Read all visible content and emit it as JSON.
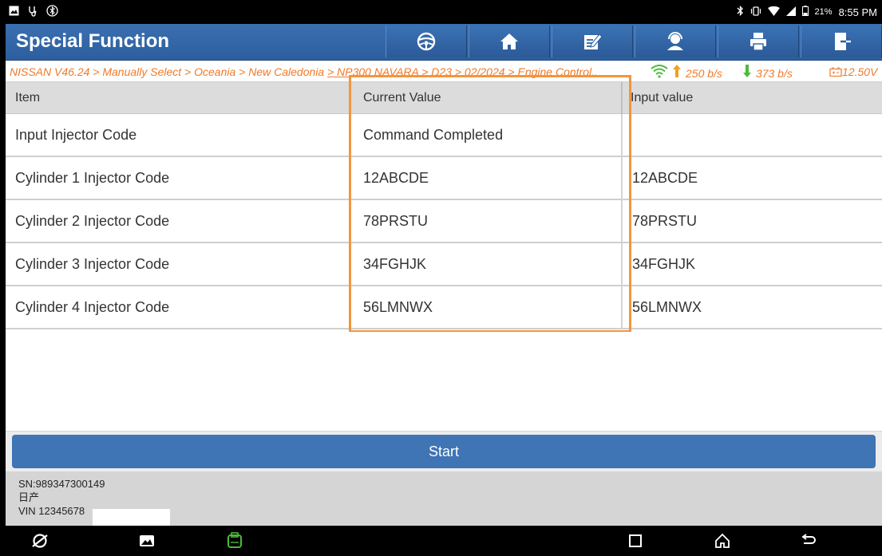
{
  "statusbar": {
    "left_icons": [
      "image-icon",
      "stethoscope-icon",
      "bluetooth-settings-icon"
    ],
    "right_icons": [
      "bluetooth-icon",
      "vibrate-icon",
      "wifi-icon",
      "signal-icon",
      "battery-icon"
    ],
    "battery": "21%",
    "time": "8:55 PM"
  },
  "header": {
    "title": "Special Function",
    "toolbar": [
      "steering-wheel-icon",
      "home-icon",
      "edit-icon",
      "support-user-icon",
      "print-icon",
      "exit-icon"
    ]
  },
  "breadcrumb": {
    "plain": "NISSAN V46.24 > Manually Select > Oceania > New Caledonia ",
    "underlined": "> NP300 NAVARA > D23 > 02/2024 > Engine Control..",
    "upload": "250 b/s",
    "download": "373 b/s",
    "voltage": "12.50V"
  },
  "table": {
    "columns": [
      "Item",
      "Current Value",
      "Input value"
    ],
    "rows": [
      {
        "item": "Input Injector Code",
        "current": "Command Completed",
        "input": ""
      },
      {
        "item": "Cylinder 1 Injector Code",
        "current": "12ABCDE",
        "input": "12ABCDE"
      },
      {
        "item": "Cylinder 2 Injector Code",
        "current": "78PRSTU",
        "input": "78PRSTU"
      },
      {
        "item": "Cylinder 3 Injector Code",
        "current": "34FGHJK",
        "input": "34FGHJK"
      },
      {
        "item": "Cylinder 4 Injector Code",
        "current": "56LMNWX",
        "input": "56LMNWX"
      }
    ]
  },
  "start_button": "Start",
  "info": {
    "sn": "SN:989347300149",
    "make": "日产",
    "vin": "VIN 12345678"
  },
  "colors": {
    "header_blue": "#2d5f9f",
    "accent_orange": "#f3953e",
    "breadcrumb_orange": "#f07a28"
  },
  "navbar": [
    "browser-icon",
    "gallery-icon",
    "vci-icon",
    "recents-icon",
    "home-nav-icon",
    "back-icon"
  ]
}
